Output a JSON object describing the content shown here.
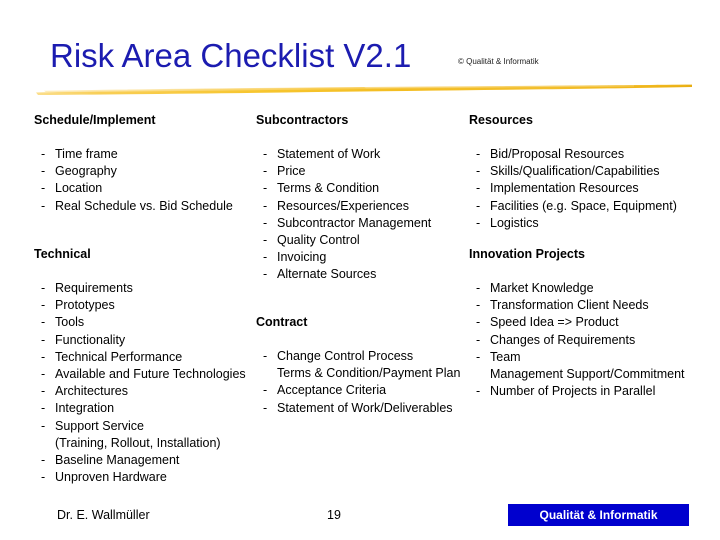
{
  "title": {
    "text": "Risk Area Checklist V2.1",
    "copyright": "© Qualität & Informatik",
    "color": "#1C1CB0",
    "rule_color": "#F5C028"
  },
  "columns": {
    "schedule": {
      "heading": "Schedule/Implement",
      "items": [
        "Time frame",
        "Geography",
        "Location",
        "Real Schedule vs. Bid Schedule"
      ]
    },
    "subcontractors": {
      "heading": "Subcontractors",
      "items": [
        "Statement of Work",
        "Price",
        "Terms & Condition",
        "Resources/Experiences",
        "Subcontractor Management",
        "Quality Control",
        "Invoicing",
        "Alternate Sources"
      ]
    },
    "resources": {
      "heading": "Resources",
      "items": [
        "Bid/Proposal Resources",
        "Skills/Qualification/Capabilities",
        "Implementation Resources",
        "Facilities (e.g. Space, Equipment)",
        "Logistics"
      ]
    },
    "technical": {
      "heading": "Technical",
      "items": [
        "Requirements",
        "Prototypes",
        "Tools",
        "Functionality",
        "Technical Performance",
        "Available and Future Technologies",
        "Architectures",
        "Integration",
        "Support Service",
        "Baseline Management",
        "Unproven Hardware"
      ],
      "continuation": "(Training, Rollout, Installation)"
    },
    "contract": {
      "heading": "Contract",
      "items": [
        "Change Control Process",
        "Terms & Condition/Payment Plan",
        "Acceptance Criteria",
        "Statement of Work/Deliverables"
      ]
    },
    "innovation": {
      "heading": "Innovation Projects",
      "items": [
        "Market Knowledge",
        "Transformation Client Needs",
        "Speed Idea  => Product",
        "Changes of Requirements",
        "Team",
        "Management Support/Commitment",
        "Number of Projects in Parallel"
      ]
    }
  },
  "bullet": "-",
  "footer": {
    "author": "Dr. E. Wallmüller",
    "page_number": "19",
    "logo_label": "Qualität & Informatik",
    "logo_bg": "#0000CE"
  }
}
